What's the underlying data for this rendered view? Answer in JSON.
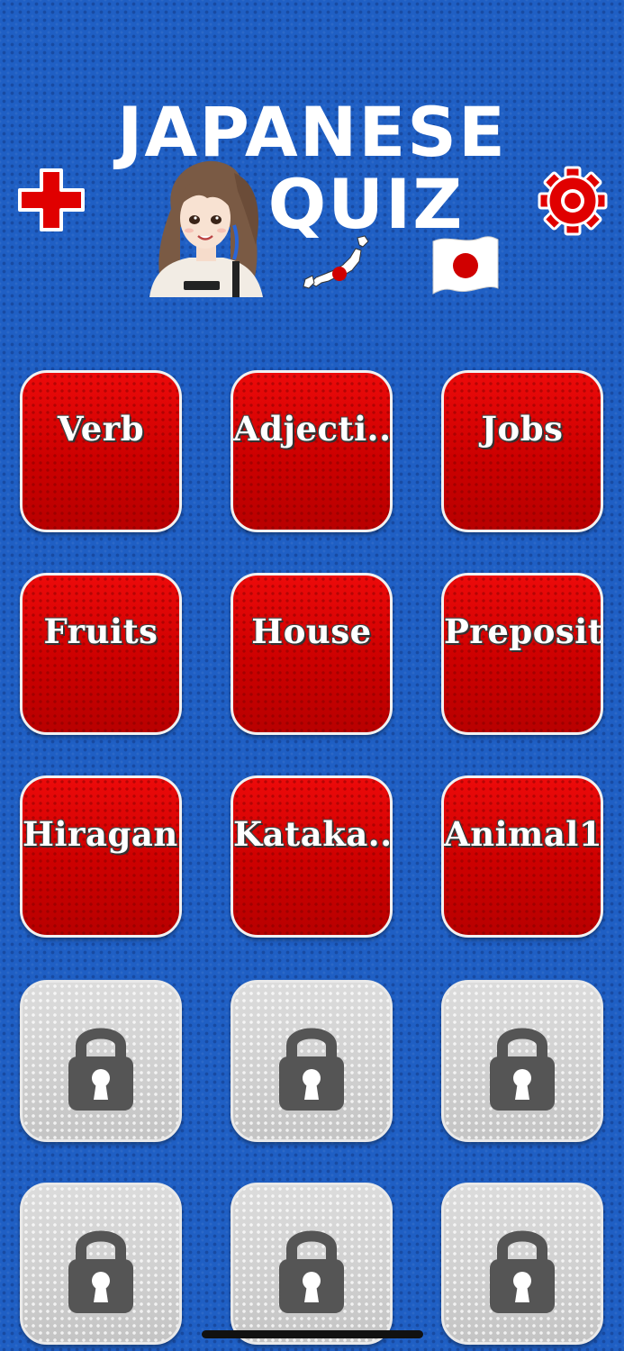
{
  "header": {
    "title_line1": "JAPANESE",
    "title_line2": "QUIZ"
  },
  "icons": {
    "add": "plus-icon",
    "settings": "gear-icon",
    "lock": "lock-icon"
  },
  "colors": {
    "background": "#1f5fc4",
    "tile_red": "#d00000",
    "tile_locked": "#d4d4d4",
    "accent_red": "#e00000"
  },
  "categories": [
    {
      "label": "Verb"
    },
    {
      "label": "Adjecti..."
    },
    {
      "label": "Jobs"
    },
    {
      "label": "Fruits"
    },
    {
      "label": "House"
    },
    {
      "label": "Preposit..."
    },
    {
      "label": "Hiragana"
    },
    {
      "label": "Kataka..."
    },
    {
      "label": "Animal1"
    }
  ],
  "locked_count": 6
}
